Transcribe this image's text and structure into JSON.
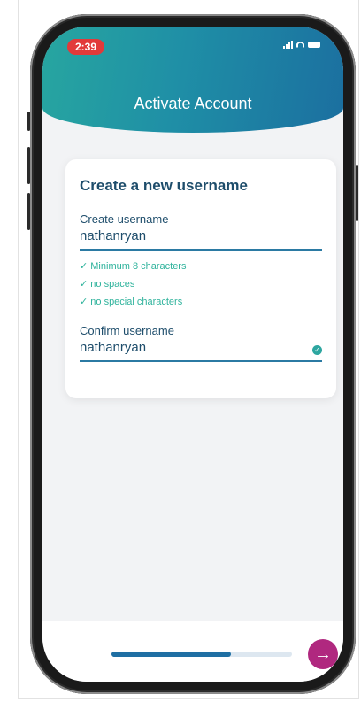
{
  "status_bar": {
    "time": "2:39"
  },
  "header": {
    "title": "Activate Account"
  },
  "form": {
    "heading": "Create a new username",
    "username_label": "Create username",
    "username_value": "nathanryan",
    "rules": [
      "✓ Minimum 8 characters",
      "✓ no spaces",
      "✓ no special characters"
    ],
    "confirm_label": "Confirm username",
    "confirm_value": "nathanryan"
  },
  "progress": {
    "fraction": 0.66
  },
  "next_button": {
    "icon": "arrow-right-icon",
    "glyph": "→"
  },
  "colors": {
    "header_gradient": [
      "#27a6a0",
      "#1b6fa0"
    ],
    "accent": "#2fb39c",
    "primary_text": "#1e4d6b",
    "next_button": "#b0287f",
    "progress": "#1f6fa3"
  }
}
